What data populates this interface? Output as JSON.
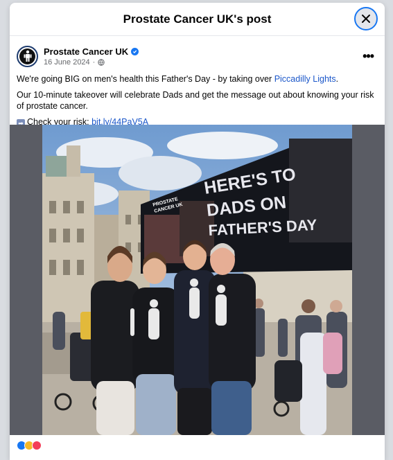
{
  "dialog": {
    "title": "Prostate Cancer UK's post"
  },
  "post": {
    "page_name": "Prostate Cancer UK",
    "date": "16 June 2024",
    "privacy_icon": "globe-icon",
    "paragraph1_text": "We're going BIG on men's health this Father's Day - by taking over ",
    "paragraph1_link": "Piccadilly Lights",
    "paragraph1_end": ".",
    "paragraph2": "Our 10-minute takeover will celebrate Dads and get the message out about knowing your risk of prostate cancer.",
    "cta_text": "Check your risk: ",
    "cta_link": "bit.ly/44PaV5A",
    "arrow_icon": "right-arrow-emoji-icon"
  },
  "billboard": {
    "line1": "HERE'S TO",
    "line2": "DADS ON",
    "line3": "FATHER'S DAY",
    "logo_line1": "PROSTATE",
    "logo_line2": "CANCER UK"
  },
  "footer": {
    "reaction_count": "",
    "comments_shares": ""
  },
  "colors": {
    "accent": "#1877f2",
    "link": "#1a56c9",
    "secondary_text": "#65676b"
  }
}
